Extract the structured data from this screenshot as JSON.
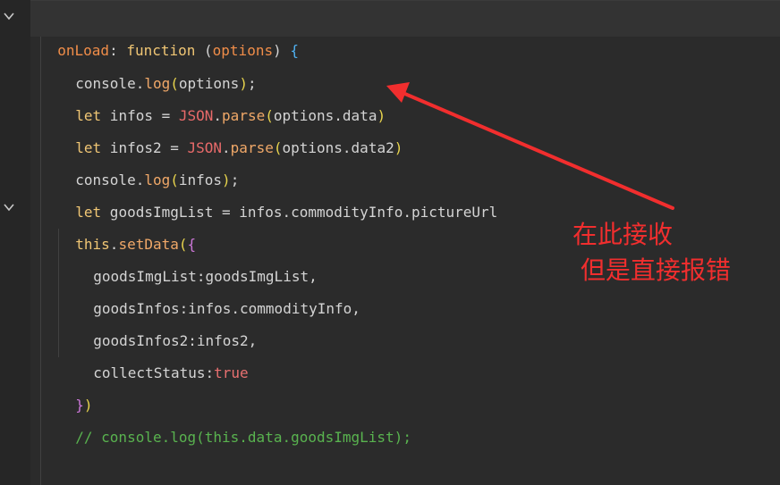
{
  "code": {
    "line1": {
      "name": "onLoad",
      "colon": ": ",
      "keyword": "function",
      "open_paren": " (",
      "param": "options",
      "close_paren": ")",
      "space": " ",
      "brace": "{"
    },
    "line2": {
      "obj": "console.",
      "method": "log",
      "open": "(",
      "arg": "options",
      "close": ")",
      "end": ";"
    },
    "line3": {
      "kw": "let",
      "text1": " infos = ",
      "json": "JSON",
      "dot": ".",
      "method": "parse",
      "open": "(",
      "arg": "options.data",
      "close": ")"
    },
    "line4": {
      "kw": "let",
      "text1": " infos2 = ",
      "json": "JSON",
      "dot": ".",
      "method": "parse",
      "open": "(",
      "arg": "options.data2",
      "close": ")"
    },
    "line5": {
      "obj": "console.",
      "method": "log",
      "open": "(",
      "arg": "infos",
      "close": ")",
      "end": ";"
    },
    "line6": {
      "kw": "let",
      "text": " goodsImgList = infos.commodityInfo.pictureUrl"
    },
    "line7": {
      "kw": "this",
      "dot": ".",
      "method": "setData",
      "open": "(",
      "brace": "{"
    },
    "line8": {
      "text": "goodsImgList:goodsImgList,"
    },
    "line9": {
      "text": "goodsInfos:infos.commodityInfo,"
    },
    "line10": {
      "text": "goodsInfos2:infos2,"
    },
    "line11": {
      "key": "collectStatus:",
      "value": "true"
    },
    "line12": {
      "brace": "}",
      "close": ")"
    },
    "line13": {
      "comment": "// console.log(this.data.goodsImgList);"
    }
  },
  "annotation": {
    "line1": "在此接收",
    "line2": " 但是直接报错",
    "color": "#f12e2e"
  },
  "gutter": {
    "fold_icons": [
      "chevron-down-icon",
      "chevron-down-icon"
    ]
  }
}
